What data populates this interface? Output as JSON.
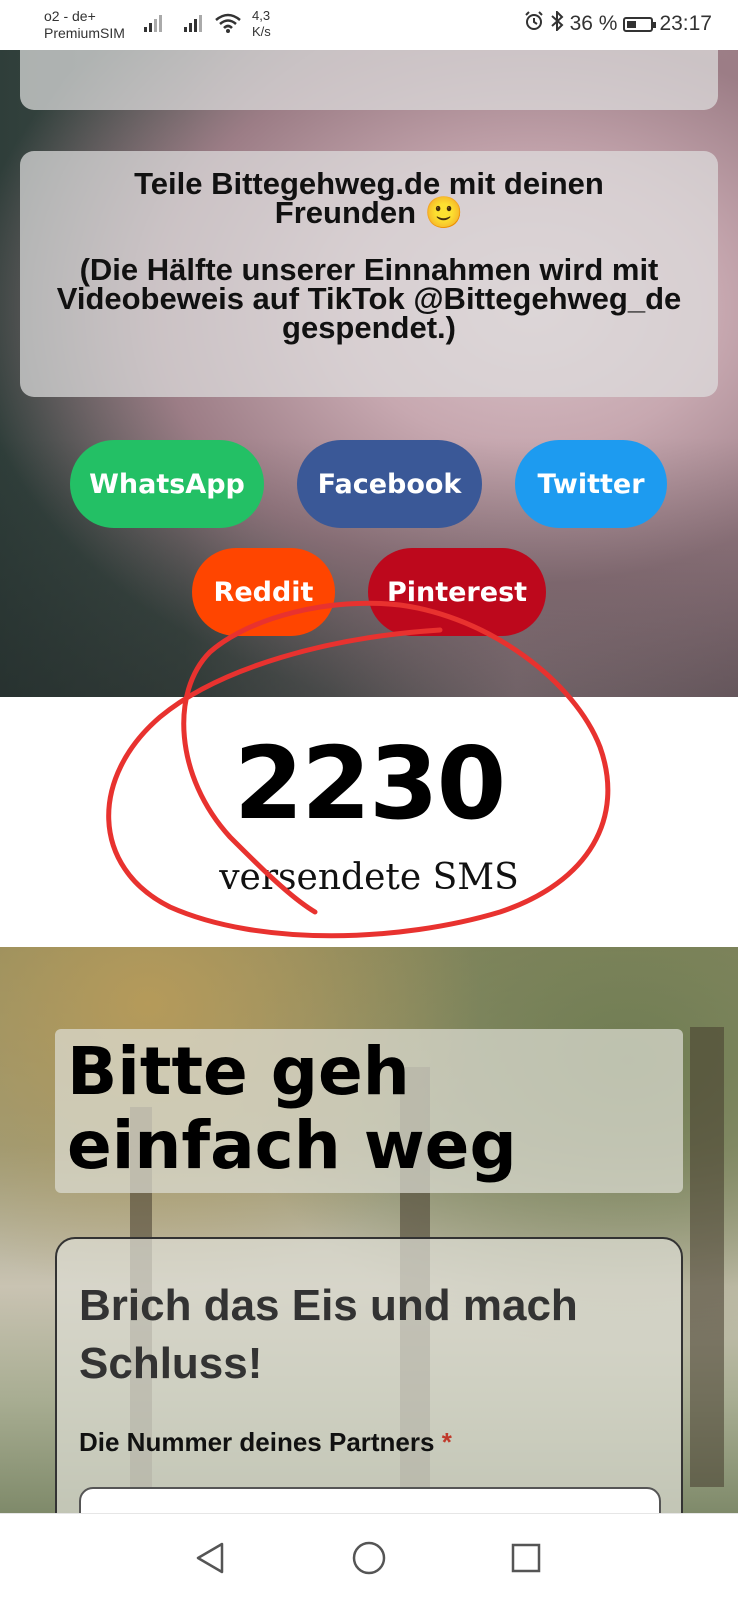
{
  "status_bar": {
    "carrier_line1": "o2 - de+",
    "carrier_line2": "PremiumSIM",
    "speed_value": "4,3",
    "speed_unit": "K/s",
    "battery": "36 %",
    "time": "23:17",
    "icons": [
      "signal-icon",
      "signal-icon",
      "wifi-icon",
      "alarm-icon",
      "bluetooth-icon",
      "battery-icon"
    ]
  },
  "share": {
    "line1": "Teile Bittegehweg.de mit deinen Freunden 🙂",
    "line2": "(Die Hälfte unserer Einnahmen wird mit Videobeweis auf TikTok @Bittegehweg_de gespendet.)"
  },
  "buttons": {
    "whatsapp": "WhatsApp",
    "facebook": "Facebook",
    "twitter": "Twitter",
    "reddit": "Reddit",
    "pinterest": "Pinterest"
  },
  "colors": {
    "whatsapp": "#23c065",
    "facebook": "#3a5897",
    "twitter": "#1d9bf0",
    "reddit": "#ff4500",
    "pinterest": "#bd081c",
    "scribble": "#e8322f"
  },
  "counter": {
    "value": "2230",
    "label": "versendete SMS"
  },
  "hero_title": "Bitte geh einfach weg",
  "form": {
    "title": "Brich das Eis und mach Schluss!",
    "partner_label": "Die Nummer deines Partners",
    "required_mark": "*",
    "partner_value": ""
  },
  "nav": [
    "back-icon",
    "home-icon",
    "recents-icon"
  ]
}
